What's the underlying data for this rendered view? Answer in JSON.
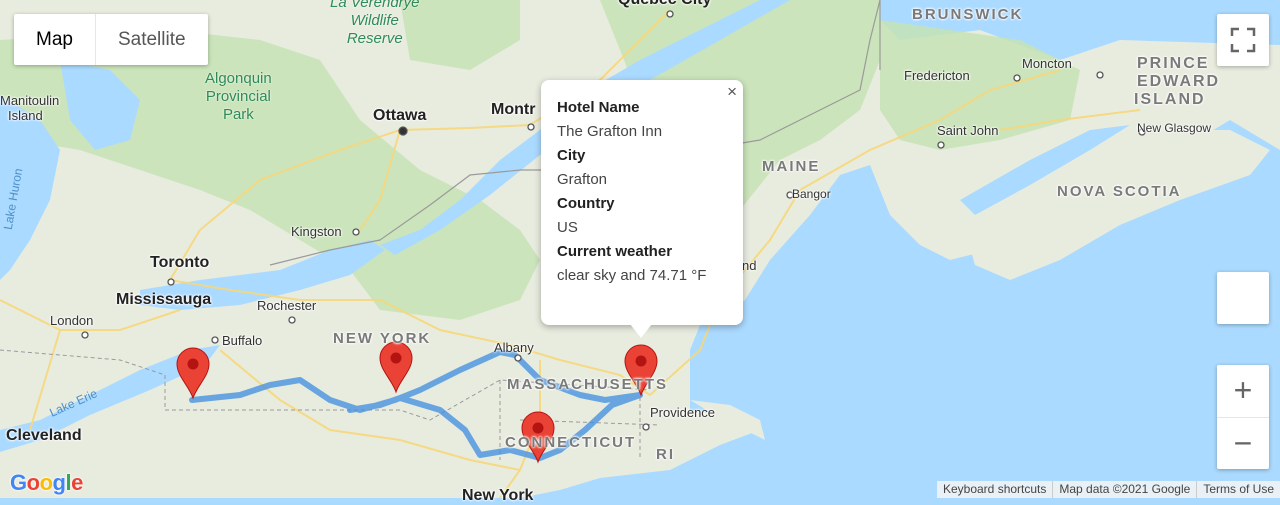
{
  "map_type": {
    "map_label": "Map",
    "satellite_label": "Satellite",
    "selected": "Map"
  },
  "labels": {
    "regions": [
      "BRUNSWICK",
      "PRINCE",
      "EDWARD",
      "ISLAND",
      "MAINE",
      "NOVA SCOTIA",
      "NEW YORK",
      "MASSACHUSETTS",
      "CONNECTICUT",
      "RI"
    ],
    "big_cities": [
      "Ottawa",
      "Toronto",
      "Mississauga",
      "Cleveland",
      "New York",
      "Quebec City",
      "Montr"
    ],
    "cities": [
      "Manitoulin",
      "Island",
      "Fredericton",
      "Moncton",
      "Saint John",
      "New Glasgow",
      "Bangor",
      "Kingston",
      "Rochester",
      "London",
      "Buffalo",
      "Albany",
      "Providence",
      "nd"
    ],
    "parks": [
      "La Verendrye",
      "Wildlife",
      "Reserve",
      "Algonquin",
      "Provincial",
      "Park"
    ],
    "water": [
      "Lake Erie",
      "Lake Huron"
    ]
  },
  "info_window": {
    "hotel_name_label": "Hotel Name",
    "hotel_name": "The Grafton Inn",
    "city_label": "City",
    "city": "Grafton",
    "country_label": "Country",
    "country": "US",
    "weather_label": "Current weather",
    "weather": "clear sky and 74.71 °F",
    "close_icon": "×"
  },
  "markers": [
    "red-map-pin",
    "red-map-pin",
    "red-map-pin",
    "red-map-pin"
  ],
  "controls": {
    "fullscreen_icon": "fullscreen-icon",
    "zoom_in": "+",
    "zoom_out": "−"
  },
  "footer": {
    "keyboard": "Keyboard shortcuts",
    "map_data": "Map data ©2021 Google",
    "terms": "Terms of Use"
  },
  "logo": "Google",
  "colors": {
    "water": "#aadaff",
    "land": "#e8ecdf",
    "forest": "#c6e3b5",
    "route": "#4a90e2",
    "marker": "#ea4335",
    "road": "#f7d77a"
  }
}
